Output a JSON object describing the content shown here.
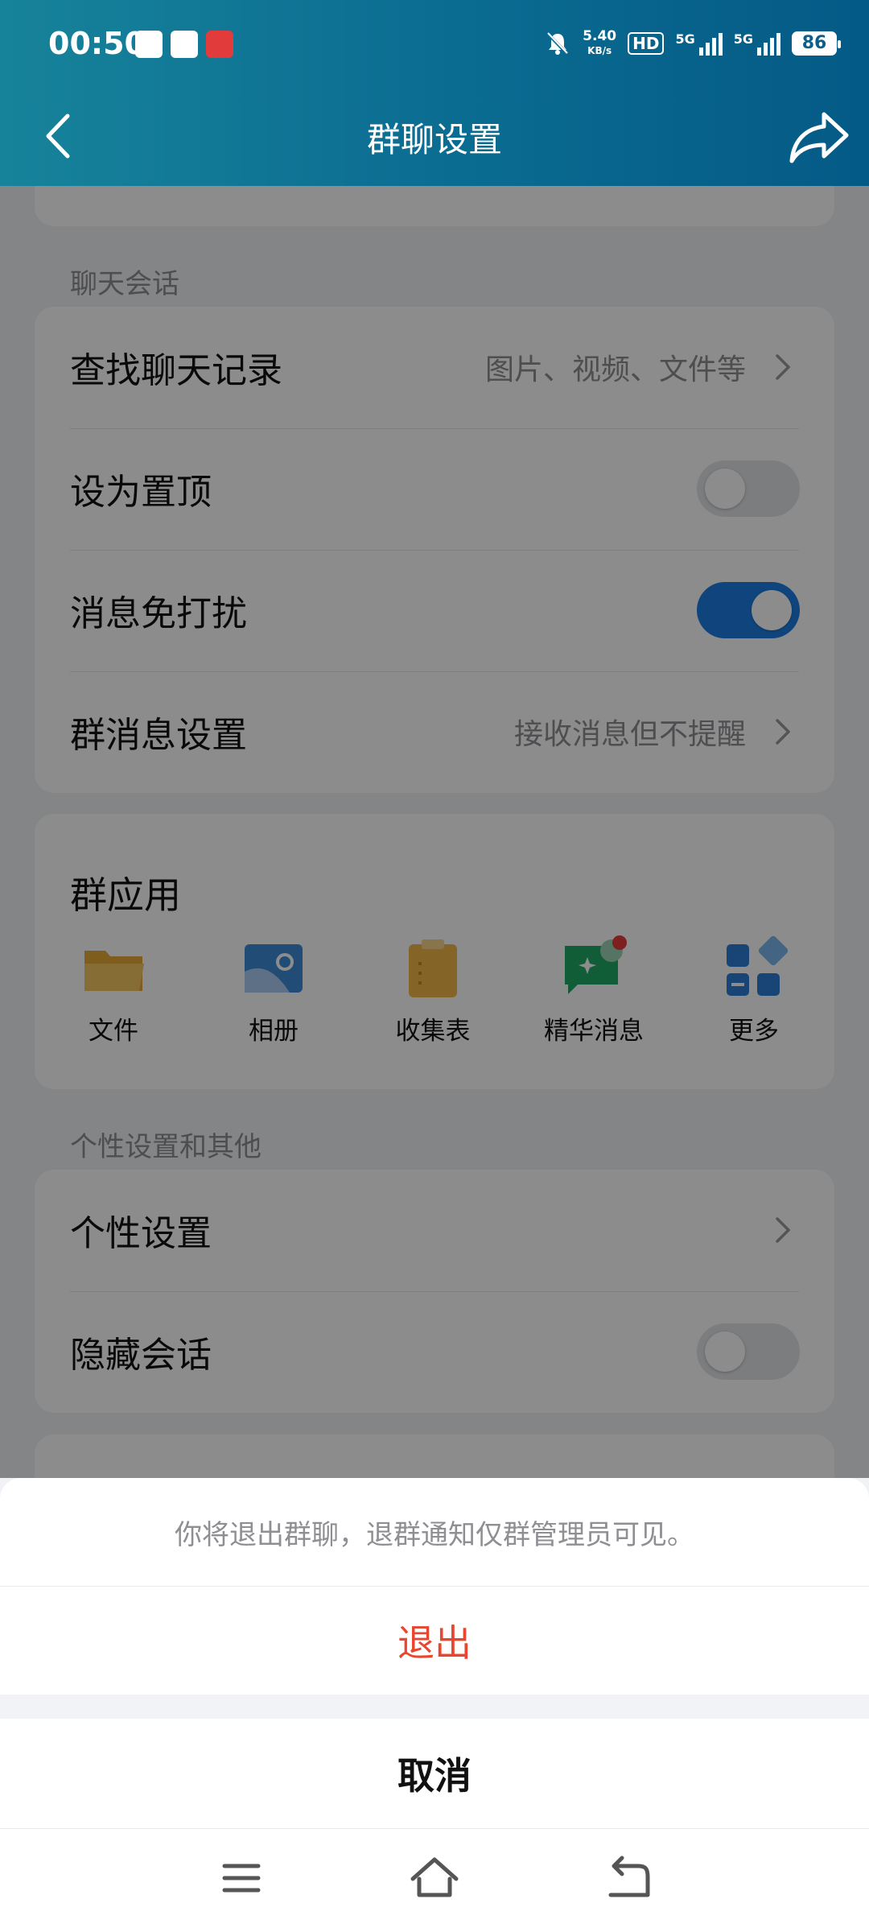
{
  "status_bar": {
    "time": "00:50",
    "net_speed_value": "5.40",
    "net_speed_unit": "KB/s",
    "hd_label": "HD",
    "sim1_label": "5G",
    "sim2_label": "5G",
    "battery": "86"
  },
  "header": {
    "title": "群聊设置"
  },
  "chat_section": {
    "label": "聊天会话",
    "items": [
      {
        "label": "查找聊天记录",
        "value": "图片、视频、文件等"
      },
      {
        "label": "设为置顶",
        "toggle": false
      },
      {
        "label": "消息免打扰",
        "toggle": true
      },
      {
        "label": "群消息设置",
        "value": "接收消息但不提醒"
      }
    ]
  },
  "group_apps": {
    "title": "群应用",
    "apps": [
      {
        "label": "文件",
        "icon": "folder-icon"
      },
      {
        "label": "相册",
        "icon": "photo-album-icon"
      },
      {
        "label": "收集表",
        "icon": "clipboard-icon"
      },
      {
        "label": "精华消息",
        "icon": "highlight-message-icon"
      },
      {
        "label": "更多",
        "icon": "more-apps-icon"
      }
    ]
  },
  "personal_section": {
    "label": "个性设置和其他",
    "items": [
      {
        "label": "个性设置"
      },
      {
        "label": "隐藏会话",
        "toggle": false
      }
    ]
  },
  "action_sheet": {
    "message": "你将退出群聊，退群通知仅群管理员可见。",
    "confirm_label": "退出",
    "cancel_label": "取消"
  },
  "colors": {
    "header_start": "#17839a",
    "header_end": "#045a86",
    "toggle_on": "#1d7fe2",
    "destructive": "#e8462e"
  }
}
